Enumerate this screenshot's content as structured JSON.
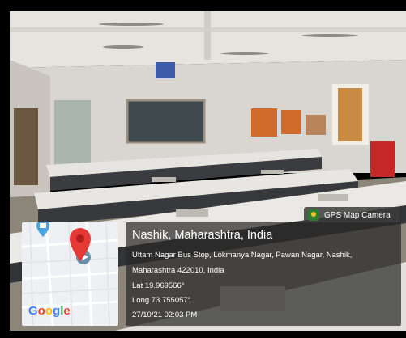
{
  "camera_badge": {
    "label": "GPS Map Camera",
    "icon": "gps-map-camera-app-icon"
  },
  "map": {
    "logo_text": "Google",
    "pin_color": "#e53935",
    "icon": "location-pin-icon"
  },
  "location": {
    "title": "Nashik, Maharashtra, India",
    "address_line1": "Uttam Nagar Bus Stop, Lokmanya Nagar, Pawan Nagar, Nashik,",
    "address_line2": "Maharashtra 422010, India",
    "latitude": "Lat 19.969566°",
    "longitude": "Long 73.755057°",
    "timestamp": "27/10/21 02:03 PM"
  },
  "blackboard": {
    "heading": ""
  }
}
